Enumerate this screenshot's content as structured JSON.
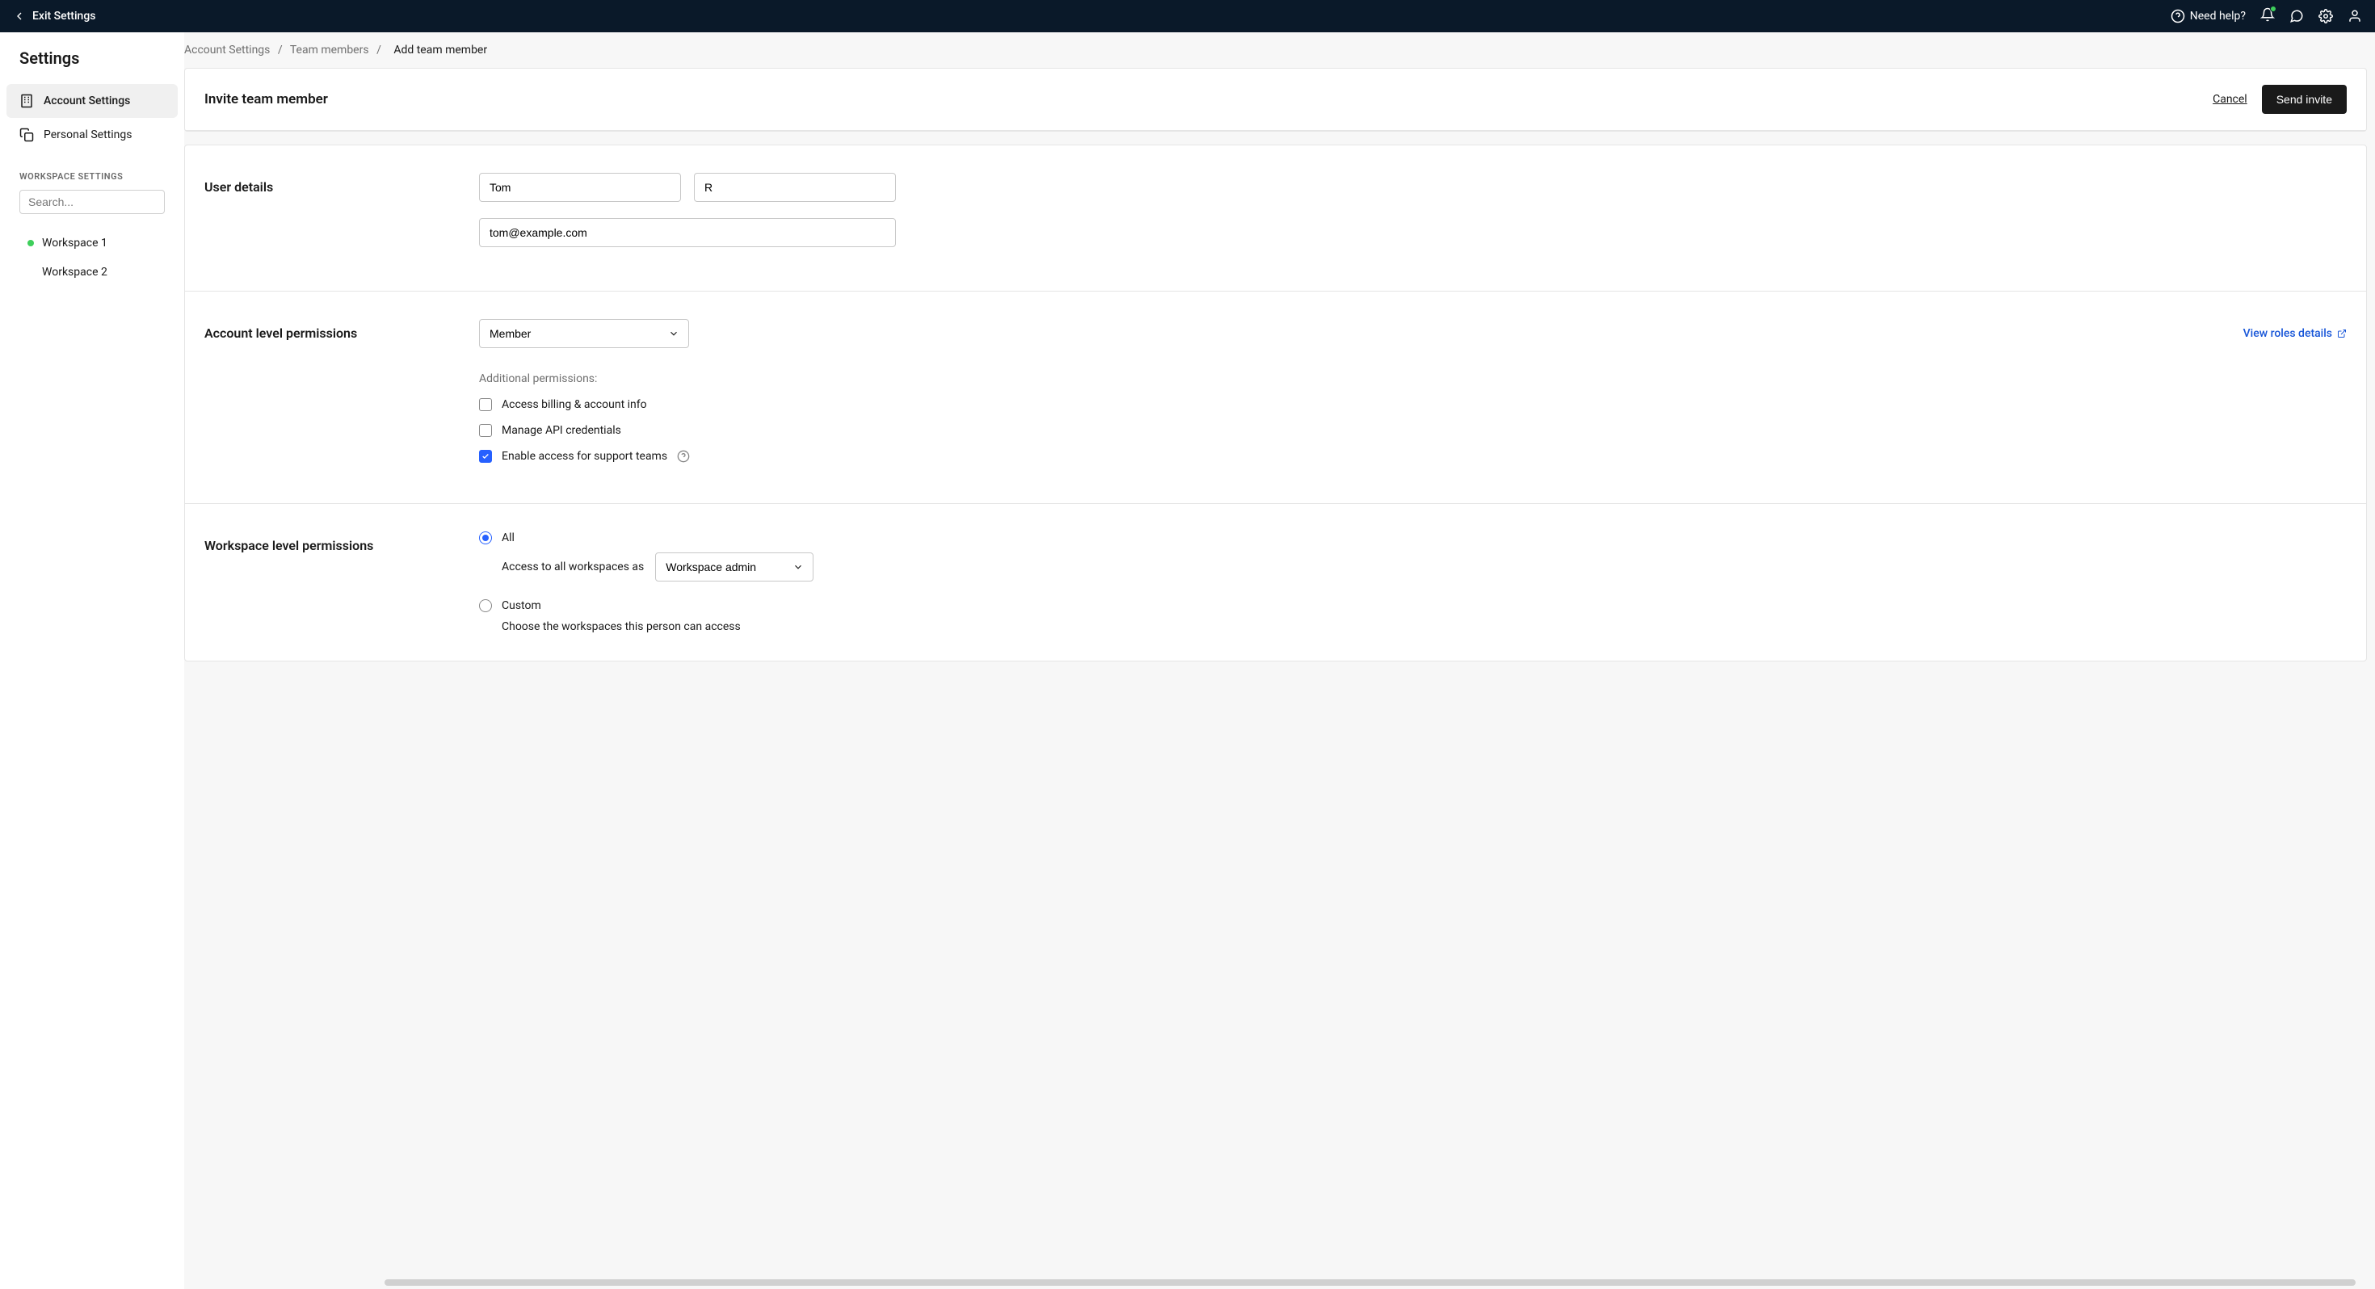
{
  "topbar": {
    "exit_label": "Exit Settings",
    "help_label": "Need help?"
  },
  "sidebar": {
    "title": "Settings",
    "nav": {
      "account": "Account Settings",
      "personal": "Personal Settings"
    },
    "ws_section_label": "WORKSPACE SETTINGS",
    "search_placeholder": "Search...",
    "workspaces": [
      {
        "name": "Workspace 1",
        "active": true
      },
      {
        "name": "Workspace 2",
        "active": false
      }
    ]
  },
  "breadcrumb": {
    "a": "Account Settings",
    "b": "Team members",
    "c": "Add team member"
  },
  "header": {
    "title": "Invite team member",
    "cancel": "Cancel",
    "send": "Send invite"
  },
  "user_details": {
    "label": "User details",
    "first_name": "Tom",
    "last_name": "R",
    "email": "tom@example.com"
  },
  "account_perms": {
    "label": "Account level permissions",
    "role": "Member",
    "view_link": "View roles details",
    "additional_label": "Additional permissions:",
    "checks": {
      "billing": "Access billing & account info",
      "api": "Manage API credentials",
      "support": "Enable access for support teams"
    }
  },
  "workspace_perms": {
    "label": "Workspace level permissions",
    "all_label": "All",
    "all_desc": "Access to all workspaces as",
    "all_role": "Workspace admin",
    "custom_label": "Custom",
    "custom_desc": "Choose the workspaces this person can access"
  }
}
